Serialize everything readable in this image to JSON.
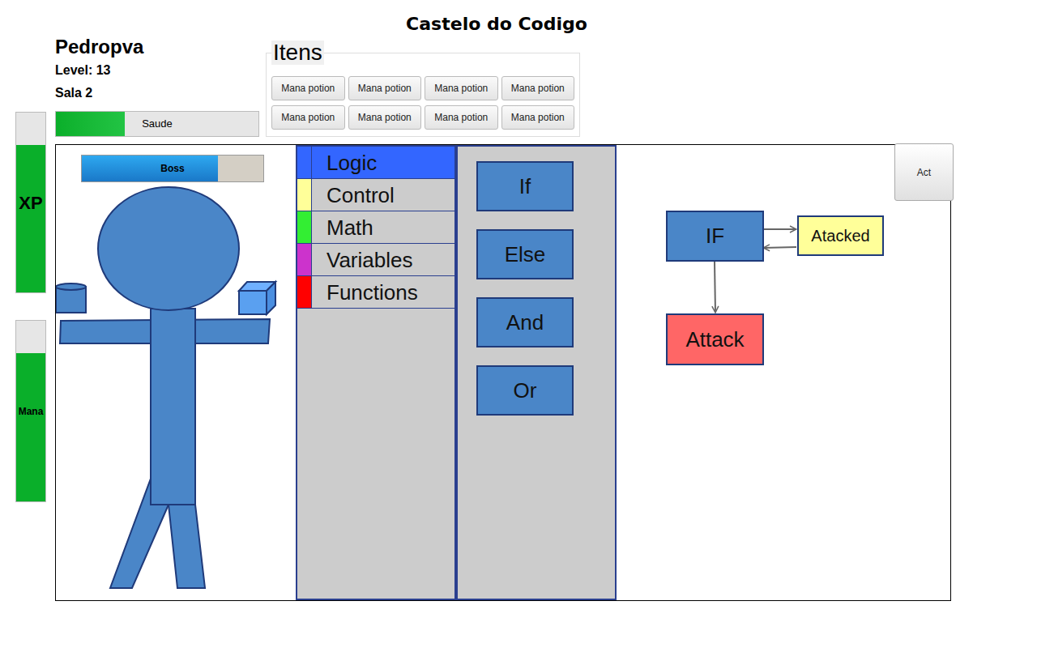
{
  "title": "Castelo do Codigo",
  "player": {
    "name": "Pedropva",
    "level": "Level: 13",
    "room": "Sala 2"
  },
  "health": {
    "label": "Saude",
    "level": 0.34
  },
  "xp": {
    "label": "XP",
    "level": 0.82
  },
  "mana": {
    "label": "Mana",
    "level": 0.82
  },
  "items": {
    "title": "Itens",
    "list": [
      {
        "label": "Mana potion"
      },
      {
        "label": "Mana potion"
      },
      {
        "label": "Mana potion"
      },
      {
        "label": "Mana potion"
      },
      {
        "label": "Mana potion"
      },
      {
        "label": "Mana potion"
      },
      {
        "label": "Mana potion"
      },
      {
        "label": "Mana potion"
      }
    ]
  },
  "boss": {
    "label": "Boss",
    "level": 0.75
  },
  "categories": [
    {
      "label": "Logic",
      "selected": true,
      "color": "#3366ff"
    },
    {
      "label": "Control",
      "selected": false,
      "color": "#ffff99"
    },
    {
      "label": "Math",
      "selected": false,
      "color": "#33ee33"
    },
    {
      "label": "Variables",
      "selected": false,
      "color": "#cc33cc"
    },
    {
      "label": "Functions",
      "selected": false,
      "color": "#ff0000"
    }
  ],
  "blocks": [
    {
      "label": "If"
    },
    {
      "label": "Else"
    },
    {
      "label": "And"
    },
    {
      "label": "Or"
    }
  ],
  "workspace": {
    "nodes": [
      {
        "label": "IF",
        "kind": "logic"
      },
      {
        "label": "Atacked",
        "kind": "control"
      },
      {
        "label": "Attack",
        "kind": "function"
      }
    ]
  },
  "act_button": "Act"
}
